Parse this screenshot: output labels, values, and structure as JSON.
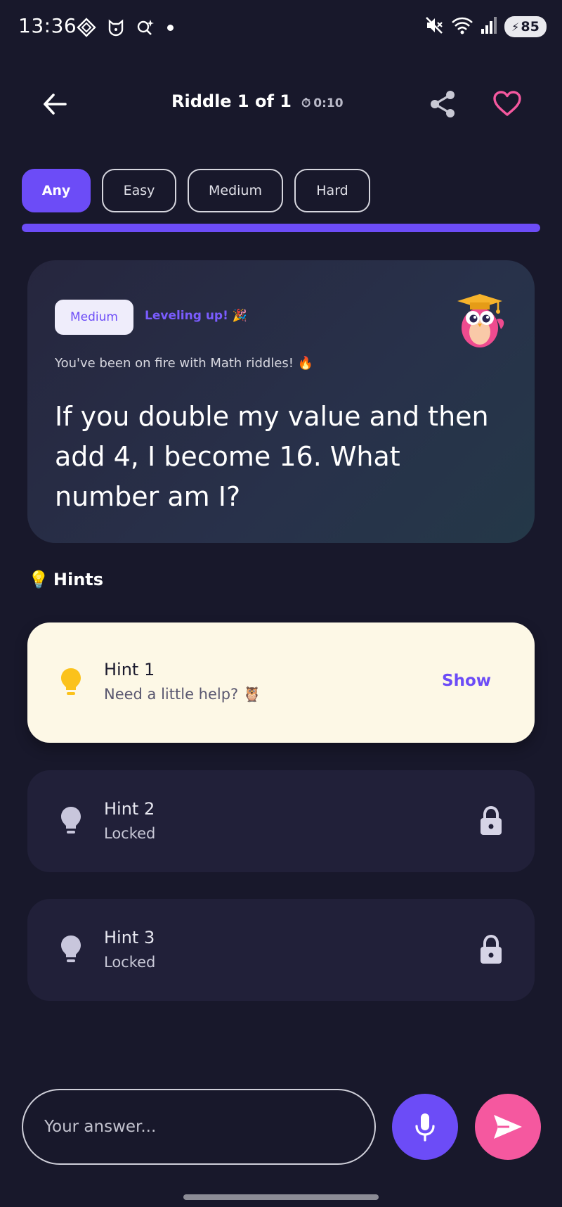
{
  "status_bar": {
    "time": "13:36",
    "battery": "85",
    "icons": [
      "grid-diamond-icon",
      "shield-cat-icon",
      "sparkle-search-icon",
      "mute-icon",
      "wifi-icon",
      "signal-icon",
      "charging-icon"
    ]
  },
  "header": {
    "title": "Riddle 1 of 1",
    "timer": "0:10"
  },
  "difficulty": {
    "chips": [
      {
        "label": "Any",
        "active": true
      },
      {
        "label": "Easy",
        "active": false
      },
      {
        "label": "Medium",
        "active": false
      },
      {
        "label": "Hard",
        "active": false
      }
    ],
    "progress": 1.0
  },
  "riddle": {
    "level": "Medium",
    "level_note": "Leveling up! 🎉",
    "streak_text": "You've been on fire with Math riddles! 🔥",
    "question": "If you double my value and then add 4, I become 16. What number am I?"
  },
  "hints": {
    "heading": "Hints",
    "items": [
      {
        "title": "Hint 1",
        "subtitle": "Need a little help? 🦉",
        "action": "Show",
        "state": "available"
      },
      {
        "title": "Hint 2",
        "subtitle": "Locked",
        "state": "locked"
      },
      {
        "title": "Hint 3",
        "subtitle": "Locked",
        "state": "locked"
      }
    ]
  },
  "answer": {
    "placeholder": "Your answer...",
    "value": ""
  },
  "colors": {
    "background": "#18182b",
    "accent": "#6c4cf7",
    "pink": "#f5589f",
    "hint_open_bg": "#fdf8e6",
    "hint_locked_bg": "#212039"
  }
}
